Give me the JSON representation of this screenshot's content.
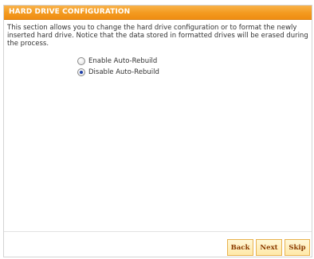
{
  "header": {
    "title": "HARD DRIVE CONFIGURATION"
  },
  "description": "This section allows you to change the hard drive configuration or to format the newly inserted hard drive. Notice that the data stored in formatted drives will be erased during the process.",
  "options": [
    {
      "label": "Enable Auto-Rebuild",
      "selected": false
    },
    {
      "label": "Disable Auto-Rebuild",
      "selected": true
    }
  ],
  "buttons": {
    "back": "Back",
    "next": "Next",
    "skip": "Skip"
  },
  "colors": {
    "header_orange": "#f39a1f",
    "button_fill": "#ffe9a8",
    "button_text": "#8a3a00"
  }
}
